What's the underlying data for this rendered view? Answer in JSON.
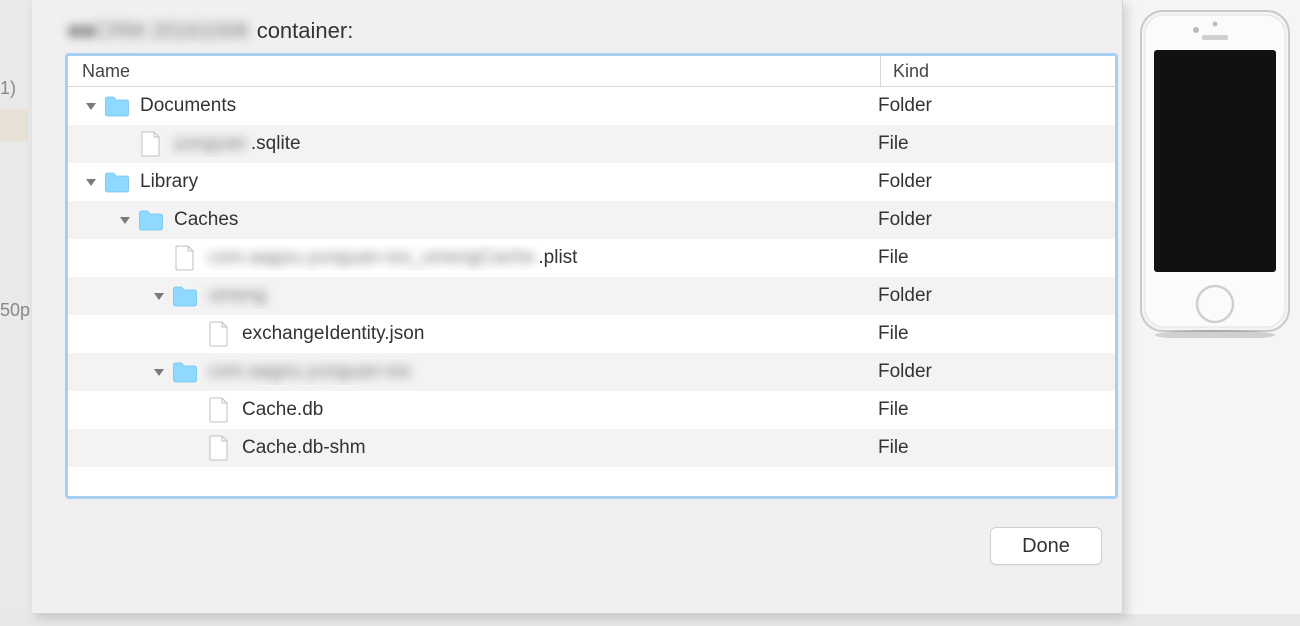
{
  "background": {
    "left_fragments": [
      "1)",
      "50p"
    ]
  },
  "dialog": {
    "title_prefix_blur": "■■CRM 20161006",
    "title_suffix": "container:",
    "done_button": "Done",
    "table": {
      "columns": {
        "name": "Name",
        "kind": "Kind"
      },
      "rows": [
        {
          "indent": 0,
          "expanded": true,
          "type": "folder",
          "name": "Documents",
          "name_blur": "",
          "kind": "Folder"
        },
        {
          "indent": 1,
          "expanded": null,
          "type": "file",
          "name": ".sqlite",
          "name_blur": "yunguan",
          "kind": "File"
        },
        {
          "indent": 0,
          "expanded": true,
          "type": "folder",
          "name": "Library",
          "name_blur": "",
          "kind": "Folder"
        },
        {
          "indent": 1,
          "expanded": true,
          "type": "folder",
          "name": "Caches",
          "name_blur": "",
          "kind": "Folder"
        },
        {
          "indent": 2,
          "expanded": null,
          "type": "file",
          "name": ".plist",
          "name_blur": "com.aagou.yunguan-ios_umengCache",
          "kind": "File"
        },
        {
          "indent": 2,
          "expanded": true,
          "type": "folder",
          "name": "",
          "name_blur": "umeng",
          "kind": "Folder"
        },
        {
          "indent": 3,
          "expanded": null,
          "type": "file",
          "name": "exchangeIdentity.json",
          "name_blur": "",
          "kind": "File"
        },
        {
          "indent": 2,
          "expanded": true,
          "type": "folder",
          "name": "",
          "name_blur": "com.aagou.yunguan-ios",
          "kind": "Folder"
        },
        {
          "indent": 3,
          "expanded": null,
          "type": "file",
          "name": "Cache.db",
          "name_blur": "",
          "kind": "File"
        },
        {
          "indent": 3,
          "expanded": null,
          "type": "file",
          "name": "Cache.db-shm",
          "name_blur": "",
          "kind": "File"
        }
      ]
    }
  }
}
